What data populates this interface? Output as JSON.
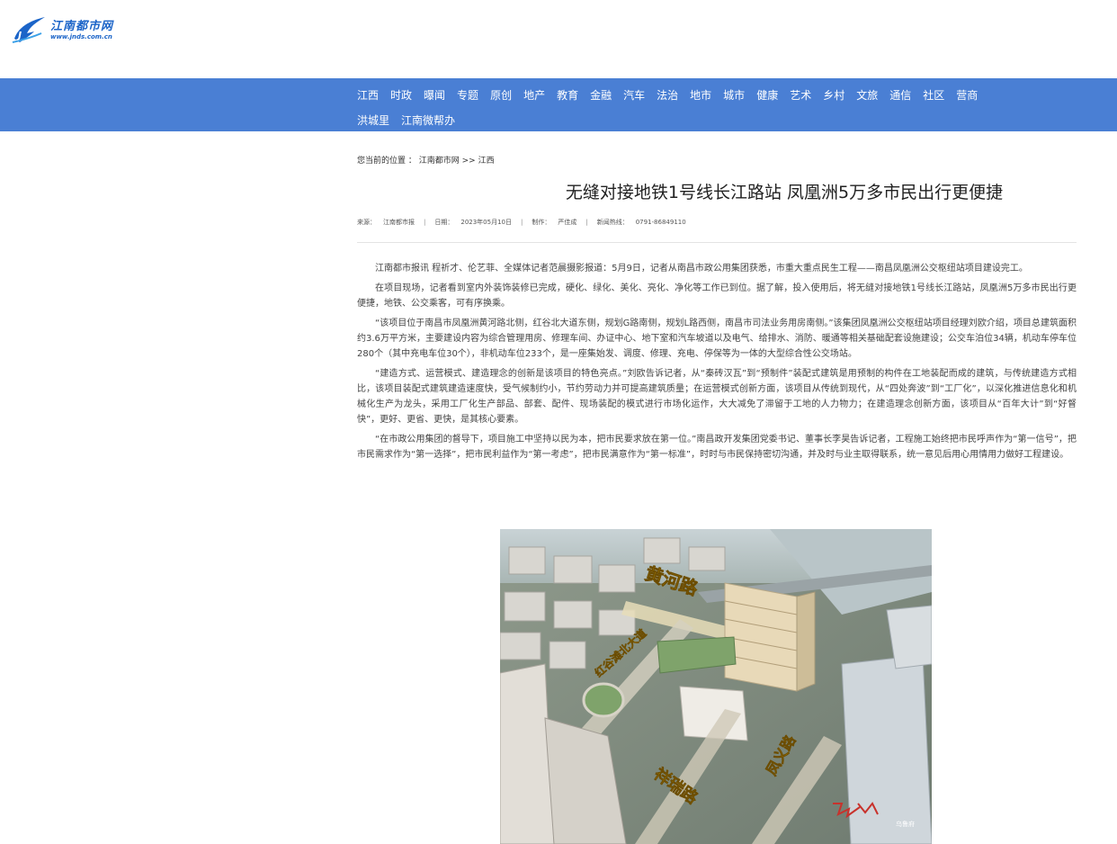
{
  "site": {
    "logo_cn": "江南都市网",
    "logo_en": "www.jnds.com.cn"
  },
  "nav": {
    "row1": [
      "江西",
      "时政",
      "曝闻",
      "专题",
      "原创",
      "地产",
      "教育",
      "金融",
      "汽车",
      "法治",
      "地市",
      "城市",
      "健康",
      "艺术",
      "乡村",
      "文旅",
      "通信",
      "社区",
      "营商"
    ],
    "row2": [
      "洪城里",
      "江南微帮办"
    ]
  },
  "breadcrumb": {
    "prefix": "您当前的位置 ：",
    "home": "江南都市网",
    "sep": ">>",
    "section": "江西"
  },
  "article": {
    "title": "无缝对接地铁1号线长江路站 凤凰洲5万多市民出行更便捷",
    "meta": {
      "source_label": "来源：",
      "source": "江南都市报",
      "date_label": "日期：",
      "date": "2023年05月10日",
      "author_label": "制作：",
      "author": "严佳成",
      "hotline_label": "新闻热线：",
      "hotline": "0791-86849110"
    },
    "paragraphs": [
      "江南都市报讯 程祈才、伦艺菲、全媒体记者范晨摄影报道：5月9日，记者从南昌市政公用集团获悉，市重大重点民生工程——南昌凤凰洲公交枢纽站项目建设完工。",
      "在项目现场，记者看到室内外装饰装修已完成，硬化、绿化、美化、亮化、净化等工作已到位。据了解，投入使用后，将无缝对接地铁1号线长江路站，凤凰洲5万多市民出行更便捷，地铁、公交乘客，可有序换乘。",
      "“该项目位于南昌市凤凰洲黄河路北侧，红谷北大道东侧，规划G路南侧，规划L路西侧，南昌市司法业务用房南侧。”该集团凤凰洲公交枢纽站项目经理刘欧介绍，项目总建筑面积约3.6万平方米，主要建设内容为综合管理用房、修理车间、办证中心、地下室和汽车坡道以及电气、给排水、消防、暖通等相关基础配套设施建设；公交车泊位34辆，机动车停车位280个（其中充电车位30个），非机动车位233个，是一座集始发、调度、修理、充电、停保等为一体的大型综合性公交场站。",
      "“建造方式、运营模式、建造理念的创新是该项目的特色亮点。”刘欧告诉记者，从“秦砖汉瓦”到“预制件”装配式建筑是用预制的构件在工地装配而成的建筑，与传统建造方式相比，该项目装配式建筑建造速度快，受气候制约小，节约劳动力并可提高建筑质量；在运营模式创新方面，该项目从传统到现代，从“四处奔波”到“工厂化”，以深化推进信息化和机械化生产为龙头，采用工厂化生产部品、部套、配件、现场装配的模式进行市场化运作，大大减免了滞留于工地的人力物力；在建造理念创新方面，该项目从“百年大计”到“好督快”，更好、更省、更快，是其核心要素。",
      "“在市政公用集团的督导下，项目施工中坚持以民为本，把市民要求放在第一位。”南昌政开发集团党委书记、董事长李昊告诉记者，工程施工始终把市民呼声作为“第一信号”，把市民需求作为“第一选择”，把市民利益作为“第一考虑”，把市民满意作为“第一标准”，时时与市民保持密切沟通，并及时与业主取得联系，统一意见后用心用情用力做好工程建设。"
    ]
  },
  "photo": {
    "road_labels": {
      "huanghe": "黄河路",
      "honggu": "红谷滩北大道",
      "xiangrui": "祥瑞路",
      "fengyi": "凤义路"
    },
    "watermark": "乌鲁府"
  }
}
